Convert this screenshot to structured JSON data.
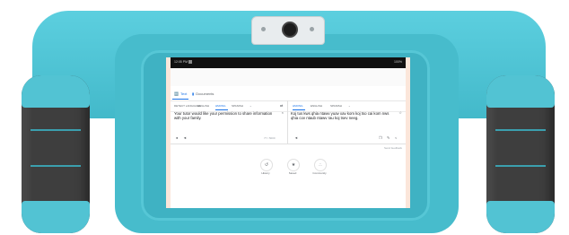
{
  "device": {
    "colors": {
      "case": "#47bccc",
      "grip": "#3e3e3e",
      "screen_surround": "#fbe6da"
    }
  },
  "status_bar": {
    "time": "12:05 PM",
    "right": "100%"
  },
  "tabs": [
    {
      "label": "Text",
      "icon": "translate-icon"
    },
    {
      "label": "Documents",
      "icon": "document-icon"
    }
  ],
  "languages": {
    "source": [
      "DETECT LANGUAGE",
      "ENGLISH",
      "HMONG",
      "SPANISH"
    ],
    "swap_icon": "swap-icon",
    "target": [
      "HMONG",
      "ENGLISH",
      "SPANISH"
    ]
  },
  "source_text": "Your tutor would like your permission to share information with your family.",
  "translated_text": "Koj tus kws qhia ntawv yuav xav kom koj tso cai kom nws qhia cov ntaub ntawv rau koj tsev neeg.",
  "counter": "77 / 5000",
  "feedback_label": "Send feedback",
  "bottom_actions": [
    {
      "label": "History",
      "icon": "history-icon"
    },
    {
      "label": "Saved",
      "icon": "star-icon"
    },
    {
      "label": "Community",
      "icon": "community-icon"
    }
  ]
}
